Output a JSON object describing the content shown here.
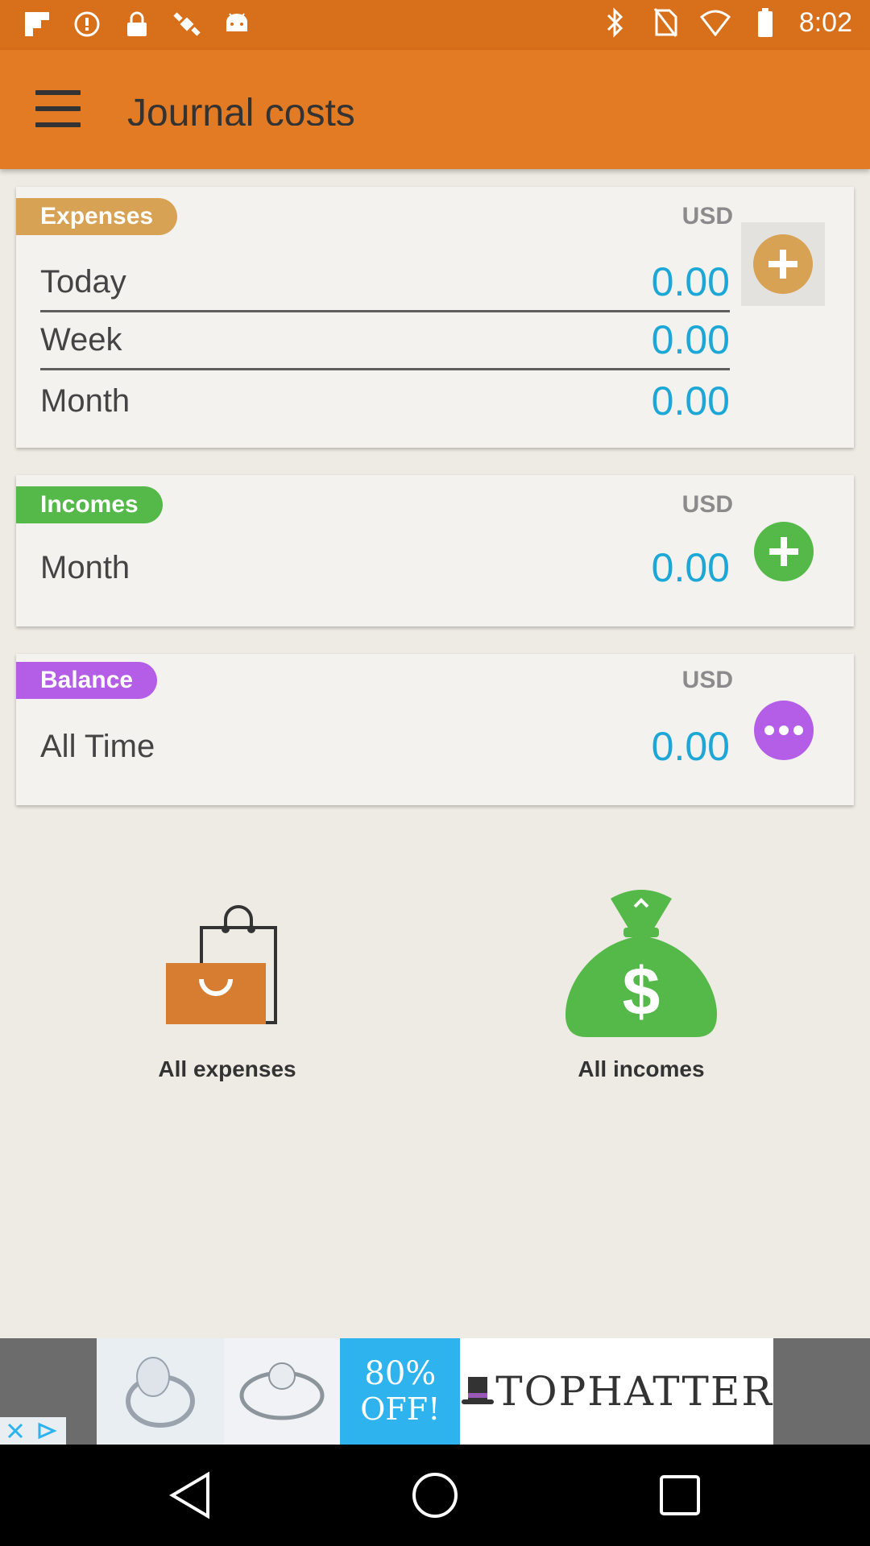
{
  "status_bar": {
    "time": "8:02",
    "icons": [
      "flipboard-icon",
      "notification-icon",
      "lock-icon",
      "fake-gps-icon",
      "android-icon",
      "bluetooth-icon",
      "no-sim-icon",
      "wifi-off-icon",
      "battery-icon"
    ]
  },
  "app_bar": {
    "title": "Journal costs",
    "menu_icon": "hamburger-menu-icon"
  },
  "expenses": {
    "label": "Expenses",
    "currency": "USD",
    "rows": [
      {
        "label": "Today",
        "value": "0.00"
      },
      {
        "label": "Week",
        "value": "0.00"
      },
      {
        "label": "Month",
        "value": "0.00"
      }
    ],
    "action_icon": "add-circle-icon",
    "color": "#d7a254"
  },
  "incomes": {
    "label": "Incomes",
    "currency": "USD",
    "rows": [
      {
        "label": "Month",
        "value": "0.00"
      }
    ],
    "action_icon": "add-circle-icon",
    "color": "#54b948"
  },
  "balance": {
    "label": "Balance",
    "currency": "USD",
    "rows": [
      {
        "label": "All Time",
        "value": "0.00"
      }
    ],
    "action_icon": "more-dots-icon",
    "color": "#b45ee8"
  },
  "shortcuts": {
    "all_expenses": "All expenses",
    "all_incomes": "All incomes"
  },
  "ad": {
    "offer_pct": "80%",
    "offer_word": "OFF!",
    "brand": "TOPHATTER"
  },
  "colors": {
    "status_bar": "#d86f1a",
    "app_bar": "#e27b24",
    "value_text": "#1ca7d6",
    "background": "#eeebe4"
  }
}
